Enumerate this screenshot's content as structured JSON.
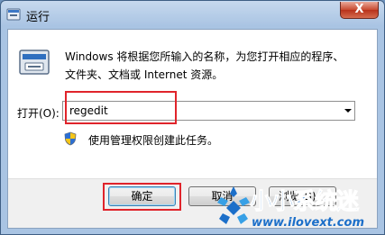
{
  "window": {
    "title": "运行",
    "close_label": "X"
  },
  "dialog": {
    "description_line1": "Windows 将根据您所输入的名称，为您打开相应的程序、",
    "description_line2": "文件夹、文档或 Internet 资源。",
    "open_label": "打开(O):",
    "open_value": "regedit",
    "admin_note": "使用管理权限创建此任务。"
  },
  "buttons": {
    "ok": "确定",
    "cancel": "取消",
    "browse": "浏览(B)..."
  },
  "watermark": {
    "title": "小小系统迷",
    "url": "www.ilovext.com"
  },
  "colors": {
    "highlight": "#e0242b",
    "watermark_blue": "#1c6fc9"
  }
}
